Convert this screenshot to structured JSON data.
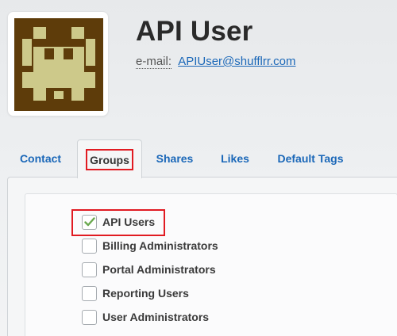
{
  "profile": {
    "name": "API User",
    "email_label": "e-mail:",
    "email": "APIUser@shufflrr.com",
    "avatar_icon": "pixel-invader-avatar"
  },
  "tabs": [
    {
      "label": "Contact",
      "active": false
    },
    {
      "label": "Groups",
      "active": true
    },
    {
      "label": "Shares",
      "active": false
    },
    {
      "label": "Likes",
      "active": false
    },
    {
      "label": "Default Tags",
      "active": false
    }
  ],
  "groups": [
    {
      "label": "API Users",
      "checked": true
    },
    {
      "label": "Billing Administrators",
      "checked": false
    },
    {
      "label": "Portal Administrators",
      "checked": false
    },
    {
      "label": "Reporting Users",
      "checked": false
    },
    {
      "label": "User Administrators",
      "checked": false
    }
  ],
  "colors": {
    "link": "#1a67b8",
    "highlight": "#e11b22",
    "avatar_dark": "#5e3c0a",
    "avatar_light": "#cdc98a",
    "check_green": "#6aa84f"
  }
}
